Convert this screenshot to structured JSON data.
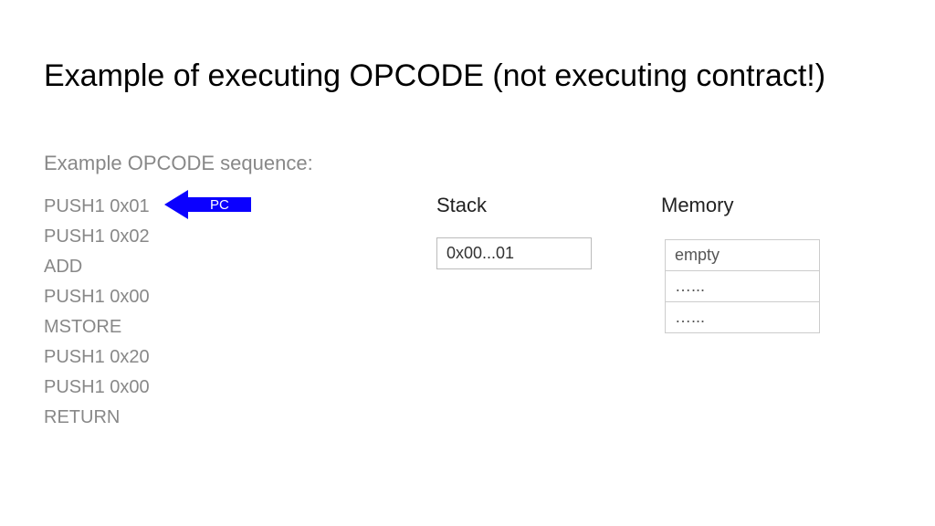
{
  "title": "Example of executing OPCODE (not executing contract!)",
  "subtitle": "Example OPCODE sequence:",
  "opcodes": [
    "PUSH1 0x01",
    "PUSH1 0x02",
    "ADD",
    "PUSH1 0x00",
    "MSTORE",
    "PUSH1 0x20",
    "PUSH1 0x00",
    "RETURN"
  ],
  "pc_label": "PC",
  "stack_label": "Stack",
  "memory_label": "Memory",
  "stack": [
    "0x00...01"
  ],
  "memory": [
    "empty",
    "…...",
    "…..."
  ]
}
